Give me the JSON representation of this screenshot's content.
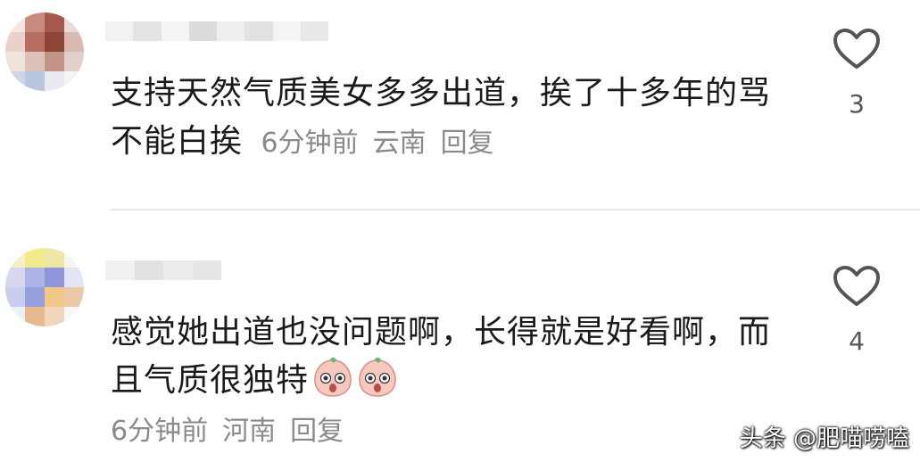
{
  "comments": [
    {
      "text": "支持天然气质美女多多出道，挨了十多年的骂不能白挨",
      "time": "6分钟前",
      "location": "云南",
      "reply_label": "回复",
      "like_count": "3"
    },
    {
      "text": "感觉她出道也没问题啊，长得就是好看啊，而且气质很独特",
      "time": "6分钟前",
      "location": "河南",
      "reply_label": "回复",
      "like_count": "4"
    }
  ],
  "watermark": "头条 @肥喵唠嗑",
  "colors": {
    "text": "#1a1a1a",
    "meta": "#8a8a8a",
    "divider": "#e6e6e6",
    "heart_stroke": "#555555"
  },
  "icons": {
    "like": "heart-outline-icon",
    "emoji": "peach-face-emoji-icon"
  }
}
